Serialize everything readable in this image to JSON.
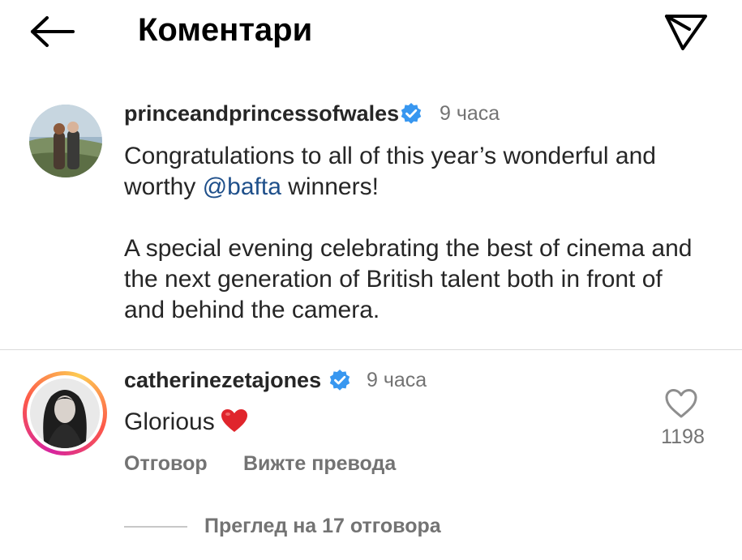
{
  "header": {
    "title": "Коментари",
    "back_icon": "arrow-left-icon",
    "share_icon": "send-icon"
  },
  "caption": {
    "username": "princeandprincessofwales",
    "verified": true,
    "time": "9 часа",
    "line1_before": "Congratulations to all of this year’s wonderful and worthy ",
    "mention": "@bafta",
    "line1_after": " winners!",
    "paragraph2": "A special evening celebrating the best of cinema and the next generation of British talent both in front of and behind the camera."
  },
  "comment": {
    "username": "catherinezetajones",
    "verified": true,
    "time": "9 часа",
    "text": "Glorious",
    "emoji": "red-heart-emoji",
    "like_icon": "heart-outline-icon",
    "like_count": "1198",
    "reply_label": "Отговор",
    "translate_label": "Вижте превода",
    "view_replies_label": "Преглед на 17 отговора"
  },
  "colors": {
    "mention": "#1e4f8a",
    "verified": "#3897f0",
    "secondary_text": "#737373",
    "emoji_heart": "#e0252c"
  }
}
